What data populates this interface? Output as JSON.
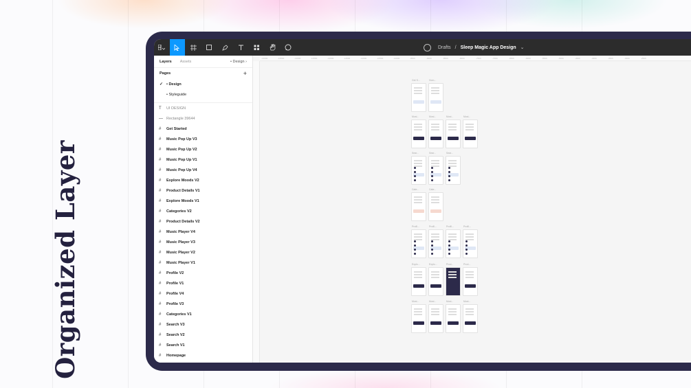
{
  "hero": {
    "title": "Organized Layer"
  },
  "toolbar": {
    "breadcrumb_root": "Drafts",
    "separator": "/",
    "file_name": "Sleep Magic App Design",
    "tools": [
      "main-menu-icon",
      "move-tool-icon",
      "frame-tool-icon",
      "shape-tool-icon",
      "pen-tool-icon",
      "text-tool-icon",
      "resources-icon",
      "hand-tool-icon",
      "comment-icon"
    ]
  },
  "sidebar": {
    "tabs": {
      "layers": "Layers",
      "assets": "Assets",
      "current_page": "• Design"
    },
    "pages_title": "Pages",
    "pages": [
      {
        "label": "• Design",
        "selected": true
      },
      {
        "label": "• Styleguide",
        "selected": false
      }
    ],
    "layers": [
      {
        "label": "UI DESIGN",
        "icon": "text-icon",
        "muted": true
      },
      {
        "label": "Rectangle 39644",
        "icon": "line-icon",
        "muted": true
      },
      {
        "label": "Get Started",
        "icon": "frame-icon"
      },
      {
        "label": "Music Pop Up V3",
        "icon": "frame-icon"
      },
      {
        "label": "Music Pop Up V2",
        "icon": "frame-icon"
      },
      {
        "label": "Music Pop Up V1",
        "icon": "frame-icon"
      },
      {
        "label": "Music Pop Up V4",
        "icon": "frame-icon"
      },
      {
        "label": "Explore Moods V2",
        "icon": "frame-icon"
      },
      {
        "label": "Product Details V1",
        "icon": "frame-icon"
      },
      {
        "label": "Explore Moods V1",
        "icon": "frame-icon"
      },
      {
        "label": "Categories V2",
        "icon": "frame-icon"
      },
      {
        "label": "Product Details V2",
        "icon": "frame-icon"
      },
      {
        "label": "Music Player V4",
        "icon": "frame-icon"
      },
      {
        "label": "Music Player V3",
        "icon": "frame-icon"
      },
      {
        "label": "Music Player V2",
        "icon": "frame-icon"
      },
      {
        "label": "Music Player V1",
        "icon": "frame-icon"
      },
      {
        "label": "Profile V2",
        "icon": "frame-icon"
      },
      {
        "label": "Profile V1",
        "icon": "frame-icon"
      },
      {
        "label": "Profile V4",
        "icon": "frame-icon"
      },
      {
        "label": "Profile V3",
        "icon": "frame-icon"
      },
      {
        "label": "Categories V1",
        "icon": "frame-icon"
      },
      {
        "label": "Search V3",
        "icon": "frame-icon"
      },
      {
        "label": "Search V2",
        "icon": "frame-icon"
      },
      {
        "label": "Search V1",
        "icon": "frame-icon"
      },
      {
        "label": "Homepage",
        "icon": "frame-icon"
      }
    ]
  },
  "canvas": {
    "ruler_marks": [
      "-14000",
      "-13500",
      "-13000",
      "-12500",
      "-12000",
      "-11500",
      "-11000",
      "-10500",
      "-10000",
      "-9500",
      "-9000",
      "-8500",
      "-8000",
      "-7500",
      "-7000",
      "-6500",
      "-6000",
      "-5500",
      "-5000",
      "-4500",
      "-4000",
      "-3500",
      "-3000",
      "-2500"
    ],
    "frame_rows": [
      {
        "labels": [
          "Get S...",
          "Hom..."
        ],
        "dark": [
          false,
          false
        ]
      },
      {
        "labels": [
          "Musi...",
          "Musi...",
          "Musi...",
          "Musi..."
        ],
        "dark": [
          false,
          false,
          false,
          false
        ]
      },
      {
        "labels": [
          "Sear...",
          "Sear...",
          "Sear..."
        ],
        "dark": [
          false,
          false,
          false
        ]
      },
      {
        "labels": [
          "Cate...",
          "Cate..."
        ],
        "dark": [
          false,
          false
        ]
      },
      {
        "labels": [
          "Profil...",
          "Profil...",
          "Profil...",
          "Profil..."
        ],
        "dark": [
          false,
          false,
          false,
          false
        ]
      },
      {
        "labels": [
          "Explo...",
          "Explo...",
          "Prod...",
          "Prod..."
        ],
        "dark": [
          false,
          false,
          true,
          false
        ]
      },
      {
        "labels": [
          "Musi...",
          "Musi...",
          "Musi...",
          "Musi..."
        ],
        "dark": [
          false,
          false,
          false,
          false
        ]
      }
    ]
  },
  "colors": {
    "frame": "#2c2a4a",
    "accent": "#0d99ff",
    "title": "#24213f"
  }
}
